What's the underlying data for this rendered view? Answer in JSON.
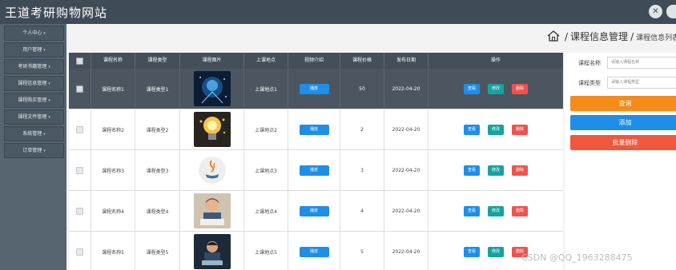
{
  "header": {
    "title": "王道考研购物网站",
    "icons": [
      "close-icon",
      "user-icon"
    ]
  },
  "sidebar": {
    "items": [
      {
        "label": "个人中心"
      },
      {
        "label": "用户管理"
      },
      {
        "label": "考研书籍管理"
      },
      {
        "label": "课程信息管理"
      },
      {
        "label": "课程购买管理"
      },
      {
        "label": "课程文件管理"
      },
      {
        "label": "系统管理"
      },
      {
        "label": "订单管理"
      }
    ]
  },
  "breadcrumb": {
    "section": "课程信息管理",
    "current": "课程信息列表",
    "separator": "/"
  },
  "table": {
    "columns": [
      "课程名称",
      "课程类型",
      "课程图片",
      "上课地点",
      "视频介绍",
      "课程价格",
      "发布日期",
      "操作"
    ],
    "intro_button": "播放",
    "actions": {
      "view": "查看",
      "edit": "修改",
      "delete": "删除"
    },
    "rows": [
      {
        "name": "课程名称1",
        "type": "课程类型1",
        "place": "上课地点1",
        "price": "50",
        "date": "2022-04-20",
        "image": "blue-tech-image"
      },
      {
        "name": "课程名称2",
        "type": "课程类型2",
        "place": "上课地点2",
        "price": "2",
        "date": "2022-04-20",
        "image": "lightbulb-image"
      },
      {
        "name": "课程名称3",
        "type": "课程类型3",
        "place": "上课地点3",
        "price": "3",
        "date": "2022-04-20",
        "image": "java-logo-image"
      },
      {
        "name": "课程名称4",
        "type": "课程类型4",
        "place": "上课地点4",
        "price": "4",
        "date": "2022-04-20",
        "image": "child-reading-image"
      },
      {
        "name": "课程名称5",
        "type": "课程类型5",
        "place": "上课地点5",
        "price": "5",
        "date": "2022-04-20",
        "image": "person-laptop-image"
      }
    ]
  },
  "search": {
    "name_label": "课程名称",
    "name_placeholder": "请输入课程名称",
    "type_label": "课程类型",
    "type_placeholder": "请输入课程类型",
    "query_button": "查询",
    "add_button": "添加",
    "batch_delete_button": "批量删除"
  },
  "watermark": "CSDN @QQ_1963288475",
  "colors": {
    "header_bg": "#3f4c57",
    "sidebar_bg": "#56656f",
    "primary": "#1e8ee8",
    "teal": "#17a2a2",
    "danger": "#ef5350",
    "warning": "#f58b1a"
  }
}
